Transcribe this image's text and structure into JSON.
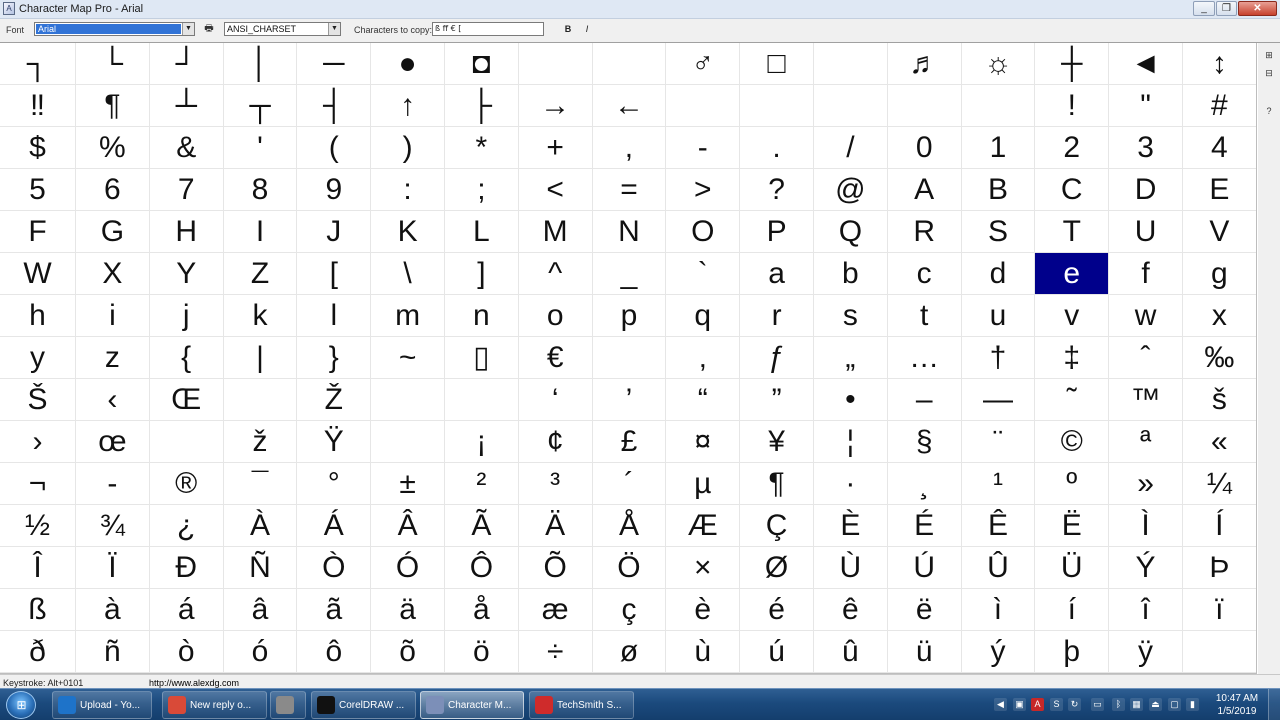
{
  "window": {
    "title": "Character Map Pro - Arial",
    "icon": "charmap-icon",
    "minimize_label": "_",
    "maximize_label": "❐",
    "close_label": "✕"
  },
  "toolbar": {
    "font_label": "Font",
    "font_value": "Arial",
    "charset_value": "ANSI_CHARSET",
    "copy_label": "Characters to copy:",
    "copy_value": "ß ff € [",
    "bold_label": "B",
    "italic_label": "I"
  },
  "grid": {
    "selected_char": "e",
    "rows": [
      [
        "┐",
        "└",
        "┘",
        "│",
        "─",
        "●",
        "◘",
        "",
        "",
        "♂",
        "□",
        "",
        "♬",
        "☼",
        "┼",
        "◄",
        "↕"
      ],
      [
        "‼",
        "¶",
        "┴",
        "┬",
        "┤",
        "↑",
        "├",
        "→",
        "←",
        "",
        "",
        "",
        "",
        "",
        "!",
        "\"",
        "#"
      ],
      [
        "$",
        "%",
        "&",
        "'",
        "(",
        ")",
        "*",
        "+",
        ",",
        "-",
        ".",
        "/",
        "0",
        "1",
        "2",
        "3",
        "4"
      ],
      [
        "5",
        "6",
        "7",
        "8",
        "9",
        ":",
        ";",
        "<",
        "=",
        ">",
        "?",
        "@",
        "A",
        "B",
        "C",
        "D",
        "E"
      ],
      [
        "F",
        "G",
        "H",
        "I",
        "J",
        "K",
        "L",
        "M",
        "N",
        "O",
        "P",
        "Q",
        "R",
        "S",
        "T",
        "U",
        "V"
      ],
      [
        "W",
        "X",
        "Y",
        "Z",
        "[",
        "\\",
        "]",
        "^",
        "_",
        "`",
        "a",
        "b",
        "c",
        "d",
        "e",
        "f",
        "g"
      ],
      [
        "h",
        "i",
        "j",
        "k",
        "l",
        "m",
        "n",
        "o",
        "p",
        "q",
        "r",
        "s",
        "t",
        "u",
        "v",
        "w",
        "x"
      ],
      [
        "y",
        "z",
        "{",
        "|",
        "}",
        "~",
        "▯",
        "€",
        "",
        "‚",
        "ƒ",
        "„",
        "…",
        "†",
        "‡",
        "ˆ",
        "‰"
      ],
      [
        "Š",
        "‹",
        "Œ",
        "",
        "Ž",
        "",
        "",
        "‘",
        "’",
        "“",
        "”",
        "•",
        "–",
        "—",
        "˜",
        "™",
        "š"
      ],
      [
        "›",
        "œ",
        "",
        "ž",
        "Ÿ",
        "",
        "¡",
        "¢",
        "£",
        "¤",
        "¥",
        "¦",
        "§",
        "¨",
        "©",
        "ª",
        "«"
      ],
      [
        "¬",
        "-",
        "®",
        "¯",
        "°",
        "±",
        "²",
        "³",
        "´",
        "µ",
        "¶",
        "·",
        "¸",
        "¹",
        "º",
        "»",
        "¼"
      ],
      [
        "½",
        "¾",
        "¿",
        "À",
        "Á",
        "Â",
        "Ã",
        "Ä",
        "Å",
        "Æ",
        "Ç",
        "È",
        "É",
        "Ê",
        "Ë",
        "Ì",
        "Í"
      ],
      [
        "Î",
        "Ï",
        "Ð",
        "Ñ",
        "Ò",
        "Ó",
        "Ô",
        "Õ",
        "Ö",
        "×",
        "Ø",
        "Ù",
        "Ú",
        "Û",
        "Ü",
        "Ý",
        "Þ"
      ],
      [
        "ß",
        "à",
        "á",
        "â",
        "ã",
        "ä",
        "å",
        "æ",
        "ç",
        "è",
        "é",
        "ê",
        "ë",
        "ì",
        "í",
        "î",
        "ï"
      ],
      [
        "ð",
        "ñ",
        "ò",
        "ó",
        "ô",
        "õ",
        "ö",
        "÷",
        "ø",
        "ù",
        "ú",
        "û",
        "ü",
        "ý",
        "þ",
        "ÿ",
        ""
      ]
    ]
  },
  "side": {
    "btn1": "⊞",
    "btn2": "⊟",
    "help": "?"
  },
  "status": {
    "keystroke": "Keystroke: Alt+0101",
    "url": "http://www.alexdg.com"
  },
  "taskbar": {
    "start_icon": "windows-flag-icon",
    "items": [
      {
        "label": "Upload - Yo...",
        "icon": "ie-icon",
        "icon_color": "#1e73c9"
      },
      {
        "label": "New reply o...",
        "icon": "chrome-icon",
        "icon_color": "#d94a38"
      },
      {
        "label": "",
        "icon": "snipping-tool-icon",
        "icon_color": "#8a8a8a"
      },
      {
        "label": "CorelDRAW ...",
        "icon": "coreldraw-icon",
        "icon_color": "#111111"
      },
      {
        "label": "Character M...",
        "icon": "charmap-icon",
        "icon_color": "#7c8fb8"
      },
      {
        "label": "TechSmith S...",
        "icon": "techsmith-icon",
        "icon_color": "#cf2b2b"
      }
    ],
    "clock_time": "10:47 AM",
    "clock_date": "1/5/2019"
  },
  "colors": {
    "selection": "#00008b",
    "font_highlight": "#3173d6",
    "taskbar": "#1b4a7d"
  }
}
